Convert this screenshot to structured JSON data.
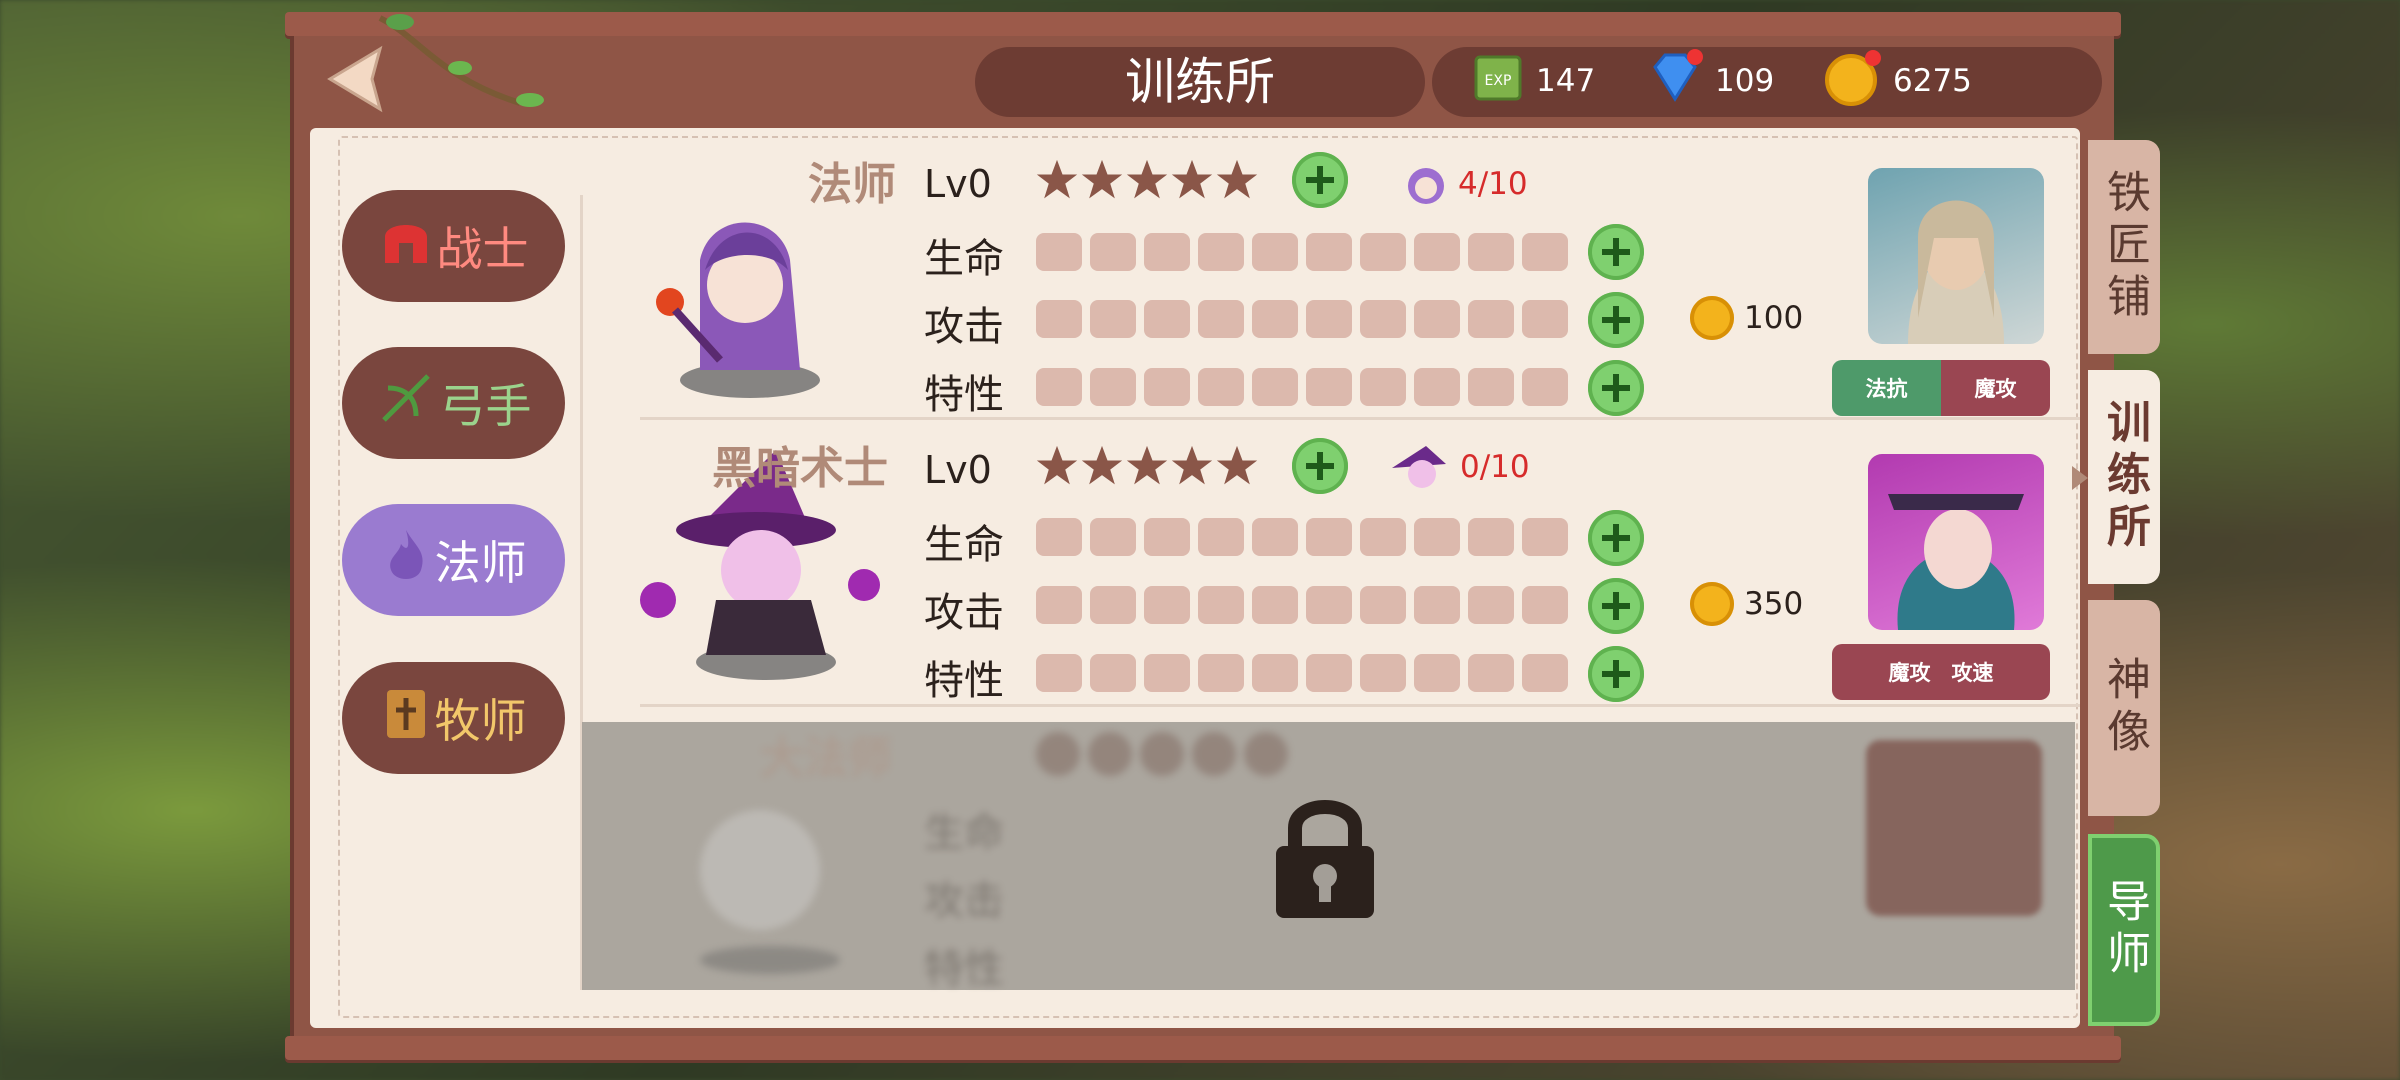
{
  "header": {
    "title": "训练所",
    "exp": "147",
    "gems": "109",
    "gold": "6275"
  },
  "class_tabs": [
    {
      "label": "战士",
      "color": "#ff8a80"
    },
    {
      "label": "弓手",
      "color": "#9bd38c"
    },
    {
      "label": "法师",
      "color": "#ffffff"
    },
    {
      "label": "牧师",
      "color": "#f2c76a"
    }
  ],
  "heroes": [
    {
      "name": "法师",
      "level": "Lv0",
      "shards": "4/10",
      "stats": [
        "生命",
        "攻击",
        "特性"
      ],
      "cost": "100",
      "tags": [
        "法抗",
        "魔攻"
      ]
    },
    {
      "name": "黑暗术士",
      "level": "Lv0",
      "shards": "0/10",
      "stats": [
        "生命",
        "攻击",
        "特性"
      ],
      "cost": "350",
      "tags": [
        "魔攻　攻速"
      ]
    },
    {
      "name": "大法师",
      "stats": [
        "生命",
        "攻击",
        "特性"
      ],
      "locked": true
    }
  ],
  "side_tabs": [
    {
      "label": "铁匠铺"
    },
    {
      "label": "训练所"
    },
    {
      "label": "神像"
    },
    {
      "label": "导师"
    }
  ]
}
